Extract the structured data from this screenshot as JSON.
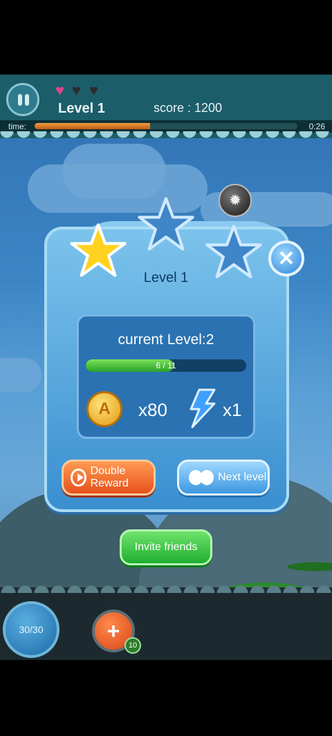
{
  "hud": {
    "hearts": [
      {
        "filled": true,
        "color": "#e0448f"
      },
      {
        "filled": false,
        "color": "#2b2b2b"
      },
      {
        "filled": false,
        "color": "#2b2b2b"
      }
    ],
    "level_label": "Level 1",
    "score_label": "score : 1200",
    "time_label": "time:",
    "time_value": "0:26",
    "time_progress": 0.44
  },
  "dialog": {
    "title": "Level 1",
    "stars_earned": 1,
    "stars_total": 3,
    "current_level_text": "current Level:2",
    "xp_text": "6 / 11",
    "xp_current": 6,
    "xp_max": 11,
    "coin_symbol": "A",
    "coin_reward": "x80",
    "energy_reward": "x1",
    "double_reward_label": "Double Reward",
    "next_level_label": "Next level"
  },
  "invite_label": "Invite friends",
  "bottom": {
    "shots_text": "30/30",
    "add_symbol": "+",
    "add_count": "10"
  },
  "colors": {
    "star_gold": "#ffd21f",
    "star_empty": "#3f86c8",
    "accent_orange": "#e6511a",
    "accent_green": "#1fae2f"
  },
  "icons": {
    "pause": "pause-icon",
    "close": "close-icon",
    "coin": "coin-icon",
    "energy": "lightning-icon",
    "play": "play-icon",
    "next": "next-icon",
    "bomb": "bomb-icon"
  }
}
